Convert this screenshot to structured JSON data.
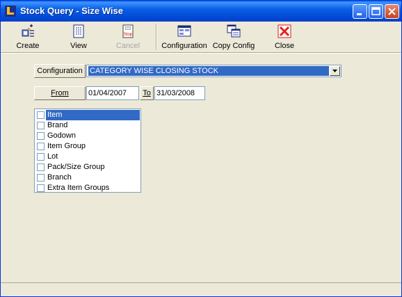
{
  "window": {
    "title": "Stock Query - Size Wise"
  },
  "toolbar": {
    "items": [
      {
        "label": "Create",
        "icon": "create-icon"
      },
      {
        "label": "View",
        "icon": "view-icon"
      },
      {
        "label": "Cancel",
        "icon": "stop-icon",
        "icon_text": "Stop",
        "disabled": true
      },
      {
        "label": "Configuration",
        "icon": "configuration-icon"
      },
      {
        "label": "Copy Config",
        "icon": "copy-config-icon"
      },
      {
        "label": "Close",
        "icon": "close-x-icon"
      }
    ]
  },
  "form": {
    "configuration_label": "Configuration",
    "configuration_value": "CATEGORY WISE CLOSING STOCK",
    "from_button": "From",
    "from_date": "01/04/2007",
    "to_button": "To",
    "to_date": "31/03/2008"
  },
  "checklist": {
    "items": [
      {
        "label": "Item",
        "checked": false,
        "selected": true
      },
      {
        "label": "Brand",
        "checked": false
      },
      {
        "label": "Godown",
        "checked": false
      },
      {
        "label": "Item Group",
        "checked": false
      },
      {
        "label": "Lot",
        "checked": false
      },
      {
        "label": "Pack/Size Group",
        "checked": false
      },
      {
        "label": "Branch",
        "checked": false
      },
      {
        "label": "Extra Item Groups",
        "checked": false
      }
    ]
  },
  "colors": {
    "titlebar": "#0a5fe4",
    "selection": "#316ac5",
    "close_red": "#e8201c",
    "window_bg": "#ece9d8"
  }
}
